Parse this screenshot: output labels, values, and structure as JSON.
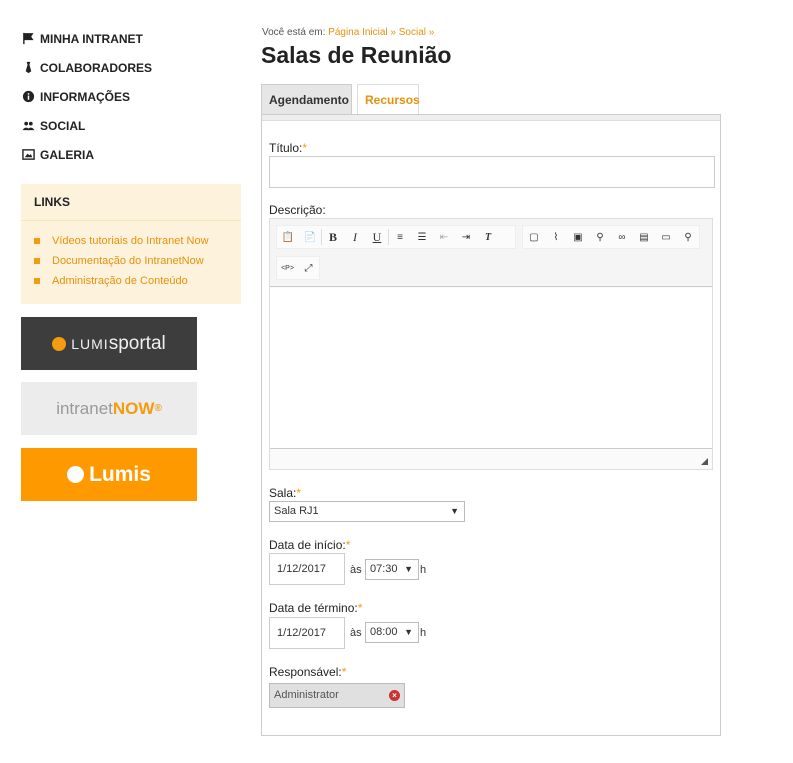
{
  "sidebar": {
    "items": [
      {
        "label": "MINHA INTRANET",
        "icon": "flag-icon"
      },
      {
        "label": "COLABORADORES",
        "icon": "tie-icon"
      },
      {
        "label": "INFORMAÇÕES",
        "icon": "info-icon"
      },
      {
        "label": "SOCIAL",
        "icon": "people-icon"
      },
      {
        "label": "GALERIA",
        "icon": "image-icon"
      }
    ],
    "links_title": "LINKS",
    "links": [
      "Vídeos tutoriais do Intranet Now",
      "Documentação do IntranetNow",
      "Administração de Conteúdo"
    ],
    "banners": {
      "lumisportal_a": "LUMI",
      "lumisportal_b": "sportal",
      "intranet_a": "intranet",
      "intranet_b": "NOW",
      "lumis": "Lumis"
    }
  },
  "breadcrumb": {
    "prefix": "Você está em:",
    "home": "Página Inicial",
    "sep": "»",
    "social": "Social",
    "sep2": "»"
  },
  "page": {
    "title": "Salas de Reunião"
  },
  "tabs": [
    {
      "label": "Agendamento",
      "active": true
    },
    {
      "label": "Recursos",
      "active": false
    }
  ],
  "form": {
    "titulo_label": "Título:",
    "descricao_label": "Descrição:",
    "sala_label": "Sala:",
    "sala_value": "Sala RJ1",
    "inicio_label": "Data de início:",
    "inicio_date": "1/12/2017",
    "inicio_time": "07:30",
    "termino_label": "Data de término:",
    "termino_date": "1/12/2017",
    "termino_time": "08:00",
    "as": "às",
    "h": "h",
    "responsavel_label": "Responsável:",
    "responsavel_value": "Administrator",
    "required_mark": "*"
  },
  "colors": {
    "accent": "#f39c12",
    "link": "#e8900c",
    "lumis_orange": "#ff9900"
  }
}
